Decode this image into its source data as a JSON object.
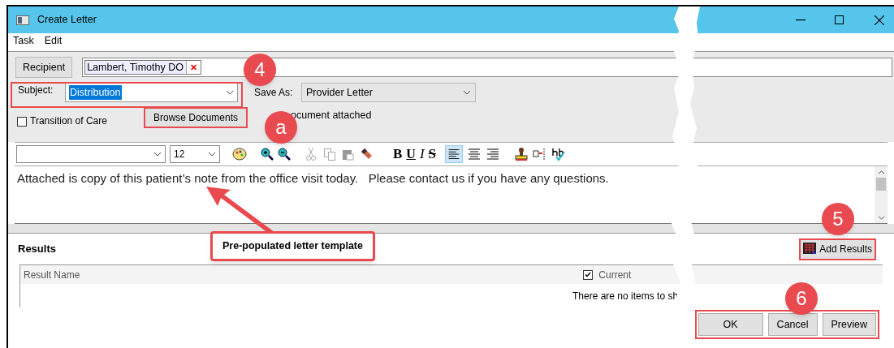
{
  "window": {
    "title": "Create Letter"
  },
  "menu": [
    "Task",
    "Edit"
  ],
  "recipient": {
    "button": "Recipient",
    "chip": "Lambert, Timothy DO",
    "remove": "✕"
  },
  "subject": {
    "label": "Subject:",
    "value": "Distribution"
  },
  "save_as": {
    "label": "Save As:",
    "value": "Provider Letter"
  },
  "transition_of_care": {
    "label": "Transition of Care",
    "checked": false
  },
  "browse_button": "Browse Documents",
  "attachment_status": "ocument attached",
  "toolbar": {
    "font_size": "12",
    "bold": "B",
    "underline": "U",
    "italic": "I",
    "strike": "S"
  },
  "body_text": "Attached is copy of this patient’s note from the office visit today.   Please contact us if you have any questions.",
  "results": {
    "title": "Results",
    "add_button": "Add Results",
    "columns": [
      {
        "label": "Result Name"
      },
      {
        "label": "Current ",
        "checked": true
      }
    ],
    "empty_message": "There are no items to sh"
  },
  "buttons": [
    "OK",
    "Cancel",
    "Preview"
  ],
  "annotations": {
    "markers": [
      "4",
      "a",
      "5",
      "6"
    ],
    "callout": "Pre-populated letter template"
  }
}
